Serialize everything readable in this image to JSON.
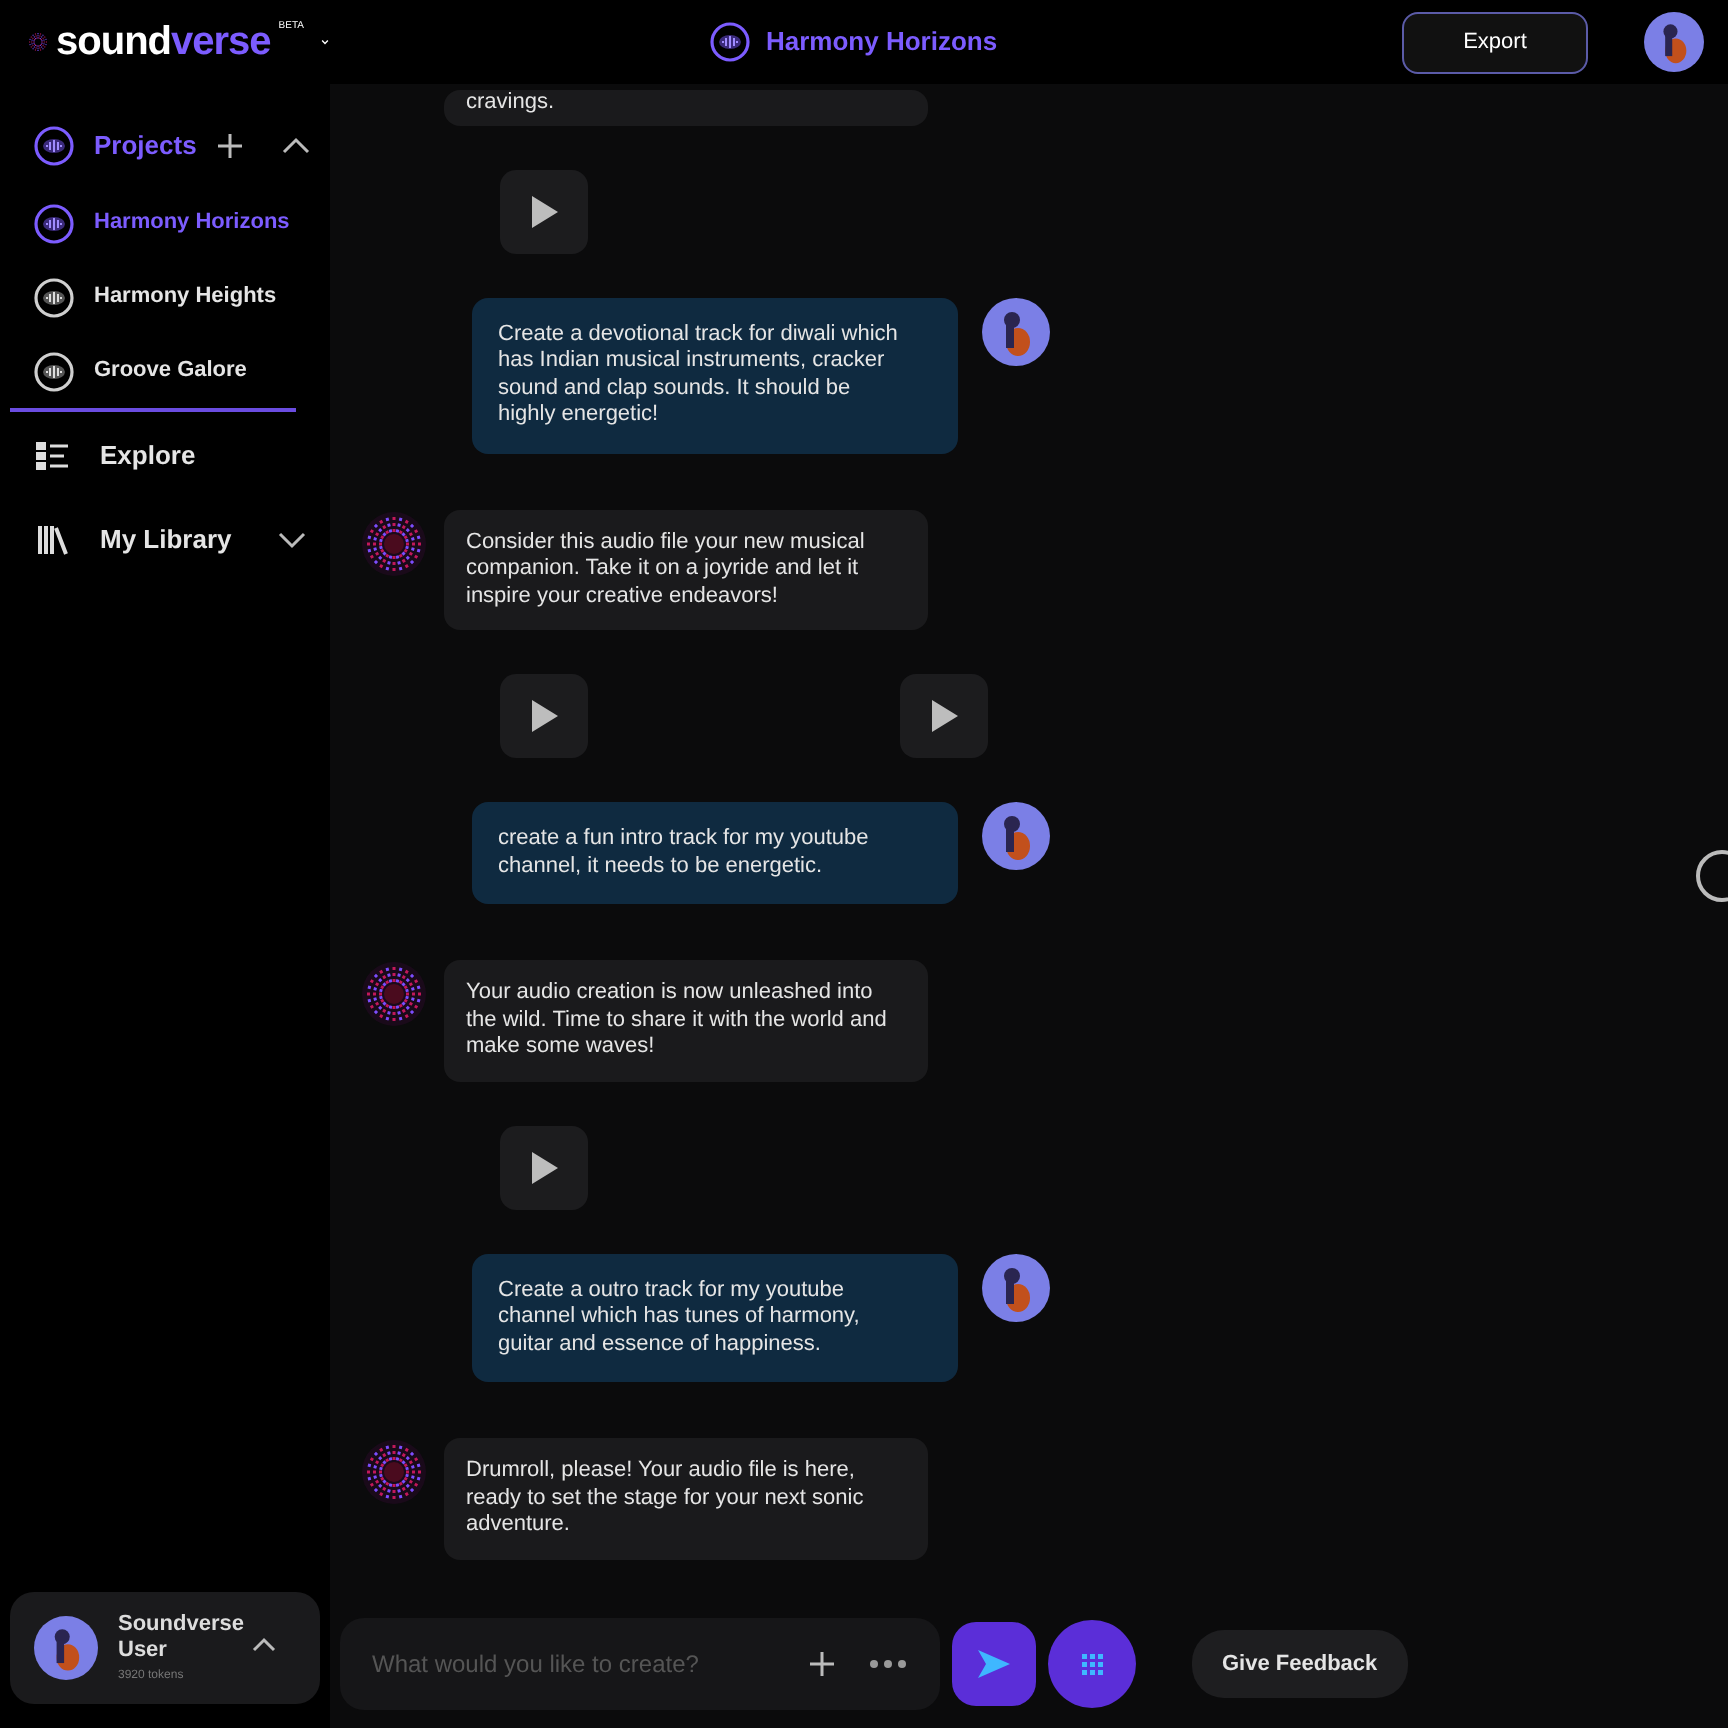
{
  "brand": {
    "name_part1": "sound",
    "name_part2": "verse",
    "badge": "BETA"
  },
  "header": {
    "project_title": "Harmony Horizons",
    "export_label": "Export"
  },
  "sidebar": {
    "projects_label": "Projects",
    "projects_expanded": true,
    "projects": [
      {
        "name": "Harmony Horizons",
        "selected": true
      },
      {
        "name": "Harmony Heights",
        "selected": false
      },
      {
        "name": "Groove Galore",
        "selected": false
      }
    ],
    "nav": [
      {
        "kind": "explore",
        "label": "Explore"
      },
      {
        "kind": "library",
        "label": "My Library",
        "expanded": false
      }
    ],
    "user": {
      "name": "Soundverse User",
      "tokens": "3920 tokens"
    }
  },
  "messages": [
    {
      "kind": "bot",
      "text": "cravings."
    },
    {
      "kind": "players",
      "tracks": [
        {
          "kind": "audio"
        }
      ]
    },
    {
      "kind": "user",
      "text": "Create a devotional track for diwali which has Indian musical instruments, cracker sound and clap sounds. It should be highly energetic!"
    },
    {
      "kind": "bot",
      "text": "Consider this audio file your new musical companion. Take it on a joyride and let it inspire your creative endeavors!"
    },
    {
      "kind": "players",
      "tracks": [
        {
          "kind": "audio"
        },
        {
          "kind": "audio"
        }
      ]
    },
    {
      "kind": "user",
      "text": "create a fun intro track for my youtube channel, it needs to be energetic."
    },
    {
      "kind": "bot",
      "text": "Your audio creation is now unleashed into the wild. Time to share it with the world and make some waves!"
    },
    {
      "kind": "players",
      "tracks": [
        {
          "kind": "audio"
        }
      ]
    },
    {
      "kind": "user",
      "text": "Create a outro track for my youtube channel which has tunes of harmony, guitar and essence of happiness."
    },
    {
      "kind": "bot",
      "text": "Drumroll, please! Your audio file is here, ready to set the stage for your next sonic adventure."
    }
  ],
  "composer": {
    "placeholder": "What would you like to create?"
  },
  "feedback_label": "Give Feedback"
}
